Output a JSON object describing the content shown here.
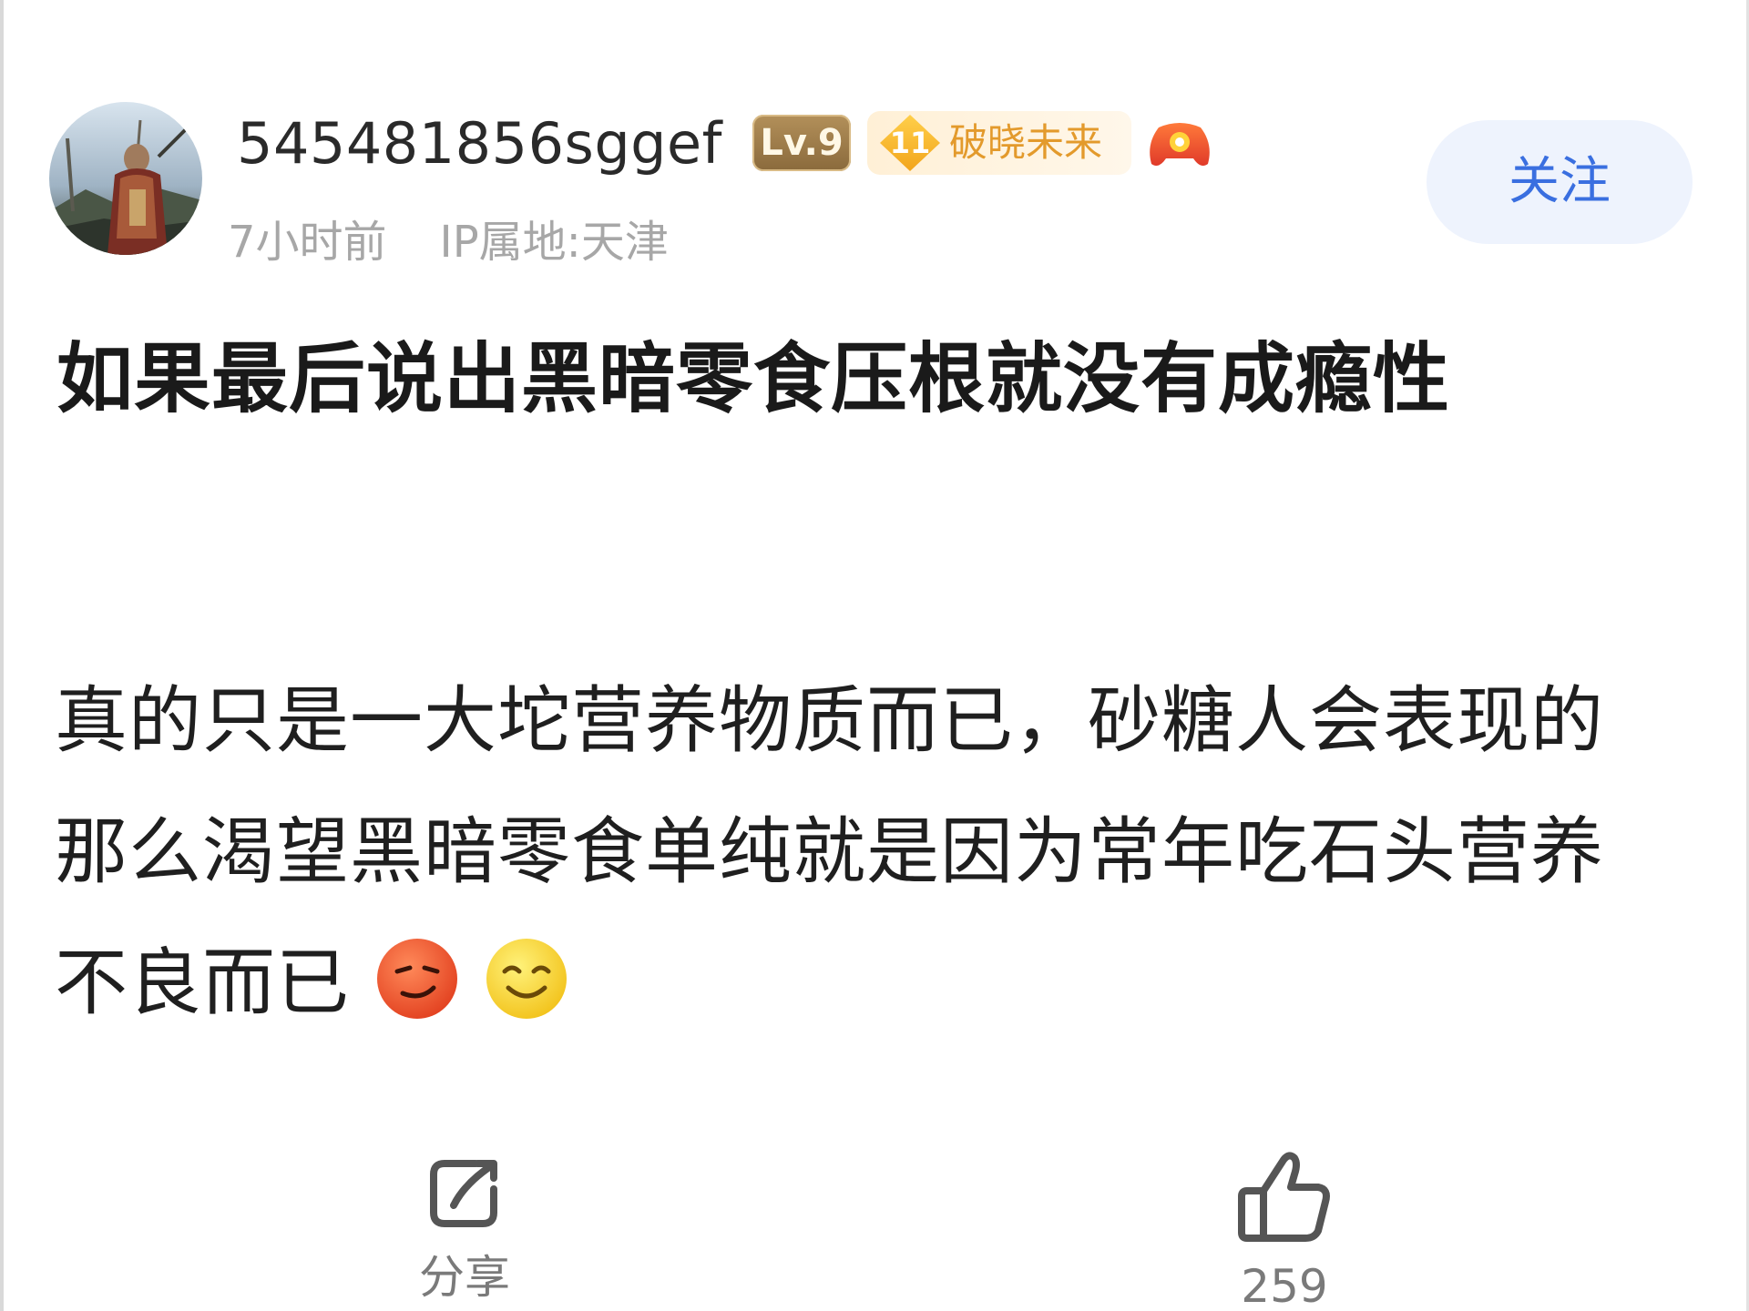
{
  "post": {
    "author": {
      "username": "545481856sggef",
      "level_badge": "Lv.9",
      "fan_badge": {
        "level": "11",
        "name": "破晓未来"
      }
    },
    "time_ago": "7小时前",
    "ip_location": "IP属地:天津",
    "follow_label": "关注",
    "title": "如果最后说出黑暗零食压根就没有成瘾性",
    "body": "真的只是一大坨营养物质而已，砂糖人会表现的那么渴望黑暗零食单纯就是因为常年吃石头营养不良而已",
    "emojis": [
      "smirk-emoji-red",
      "grin-emoji-yellow"
    ]
  },
  "actions": {
    "share_label": "分享",
    "like_count": "259"
  },
  "colors": {
    "follow_text": "#3a6fe0",
    "follow_bg": "#eef3fd",
    "meta_text": "#a7a7a7",
    "fan_badge_text": "#e39a2c"
  }
}
